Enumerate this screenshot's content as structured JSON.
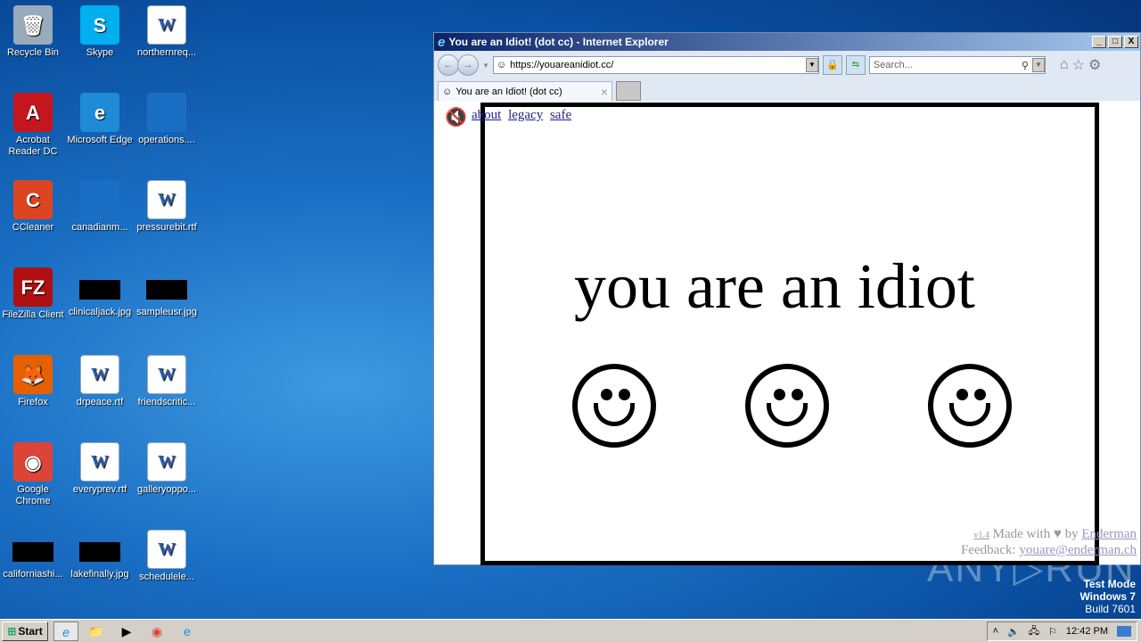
{
  "desktop": {
    "icons": [
      {
        "label": "Recycle Bin",
        "glyph": "🗑",
        "color": "#9ab"
      },
      {
        "label": "Skype",
        "glyph": "S",
        "color": "#00aff0"
      },
      {
        "label": "northernreq...",
        "glyph": "W",
        "color": "word"
      },
      {
        "label": "Acrobat Reader DC",
        "glyph": "A",
        "color": "#c4161c"
      },
      {
        "label": "Microsoft Edge",
        "glyph": "e",
        "color": "#1e8bd6"
      },
      {
        "label": "operations....",
        "glyph": "",
        "color": "#1a6fc4"
      },
      {
        "label": "CCleaner",
        "glyph": "C",
        "color": "#d42"
      },
      {
        "label": "canadianm...",
        "glyph": "",
        "color": "#1a6fc4"
      },
      {
        "label": "pressurebit.rtf",
        "glyph": "W",
        "color": "word"
      },
      {
        "label": "FileZilla Client",
        "glyph": "FZ",
        "color": "#b01010"
      },
      {
        "label": "clinicaljack.jpg",
        "glyph": "",
        "color": "blk"
      },
      {
        "label": "sampleusr.jpg",
        "glyph": "",
        "color": "blk"
      },
      {
        "label": "Firefox",
        "glyph": "🦊",
        "color": "#e66000"
      },
      {
        "label": "drpeace.rtf",
        "glyph": "W",
        "color": "word"
      },
      {
        "label": "friendscritic...",
        "glyph": "W",
        "color": "word"
      },
      {
        "label": "Google Chrome",
        "glyph": "◉",
        "color": "#db4437"
      },
      {
        "label": "everyprev.rtf",
        "glyph": "W",
        "color": "word"
      },
      {
        "label": "galleryoppo...",
        "glyph": "W",
        "color": "word"
      },
      {
        "label": "californiashi...",
        "glyph": "",
        "color": "blk"
      },
      {
        "label": "lakefinally.jpg",
        "glyph": "",
        "color": "blk"
      },
      {
        "label": "schedulele...",
        "glyph": "W",
        "color": "word"
      }
    ]
  },
  "browser": {
    "title": "You are an Idiot! (dot cc) - Internet Explorer",
    "url": "https://youareanidiot.cc/",
    "search_placeholder": "Search...",
    "tab_label": "You are an Idiot! (dot cc)",
    "tab_close": "×",
    "links": [
      "about",
      "legacy",
      "safe"
    ],
    "headline": "you are an idiot",
    "footer": {
      "version": "v1.4",
      "made_with": "Made with",
      "heart": "♥",
      "by": "by",
      "author": "Enderman",
      "feedback": "Feedback:",
      "email": "youare@enderman.ch"
    }
  },
  "taskbar": {
    "start": "Start",
    "clock": "12:42 PM"
  },
  "watermark": {
    "test_mode": "Test Mode",
    "os": "Windows 7",
    "build": "Build 7601",
    "brand": "ANY▷RUN"
  }
}
